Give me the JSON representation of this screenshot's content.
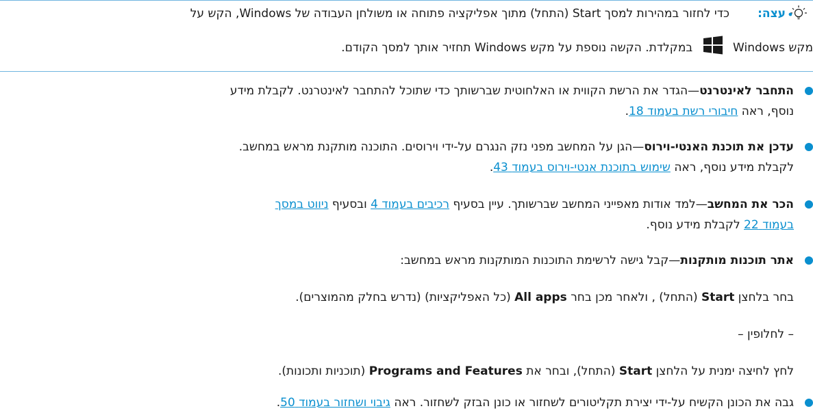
{
  "tip": {
    "label": "עצה:",
    "line1": "כדי לחזור במהירות למסך Start (התחל) מתוך אפליקציה פתוחה או משולחן העבודה של Windows, הקש על",
    "line2_before": "מקש Windows",
    "line2_after": "במקלדת. הקשה נוספת על מקש Windows תחזיר אותך למסך הקודם."
  },
  "items": [
    {
      "term": "התחבר לאינטרנט",
      "text": "—הגדר את הרשת הקווית או האלחוטית שברשותך כדי שתוכל להתחבר לאינטרנט. לקבלת מידע",
      "line2_before": "נוסף, ראה",
      "link1": "חיבורי רשת בעמוד",
      "link1_page": "18",
      "line2_after": "."
    },
    {
      "term": "עדכן את תוכנת האנטי-וירוס",
      "text": "—הגן על המחשב מפני נזק הנגרם על-ידי וירוסים. התוכנה מותקנת מראש במחשב.",
      "line2_before": "לקבלת מידע נוסף, ראה",
      "link1": "שימוש בתוכנת אנטי-וירוס בעמוד",
      "link1_page": "43",
      "line2_after": "."
    },
    {
      "term": "הכר את המחשב",
      "text": "—למד אודות מאפייני המחשב שברשותך. עיין בסעיף",
      "link_a": "רכיבים בעמוד",
      "link_a_page": "4",
      "mid": "ובסעיף",
      "link_b": "ניווט במסך",
      "line2_link": "בעמוד",
      "line2_link_page": "22",
      "line2_after": "לקבלת מידע נוסף."
    },
    {
      "term": "אתר תוכנות מותקנות",
      "text": "—קבל גישה לרשימת התוכנות המותקנות מראש במחשב:"
    },
    {
      "text_before": "גבה את הכונן הקשיח על-ידי יצירת תקליטורים לשחזור או כונן הבזק לשחזור. ראה",
      "link1": "גיבוי ושחזור בעמוד",
      "link1_page": "50",
      "after": "."
    }
  ],
  "sub": {
    "line1_a": "בחר בלחצן",
    "line1_b": "Start",
    "line1_c": "(התחל) , ולאחר מכן בחר",
    "line1_d": "All apps",
    "line1_e": "(כל האפליקציות) (נדרש בחלק מהמוצרים).",
    "alt": "– לחלופין –",
    "line3_a": "לחץ לחיצה ימנית על הלחצן",
    "line3_b": "Start",
    "line3_c": "(התחל), ובחר את",
    "line3_d": "Programs and Features",
    "line3_e": "(תוכניות ותכונות)."
  },
  "colors": {
    "accent": "#0a8fcf",
    "rule": "#6fb5e0"
  }
}
